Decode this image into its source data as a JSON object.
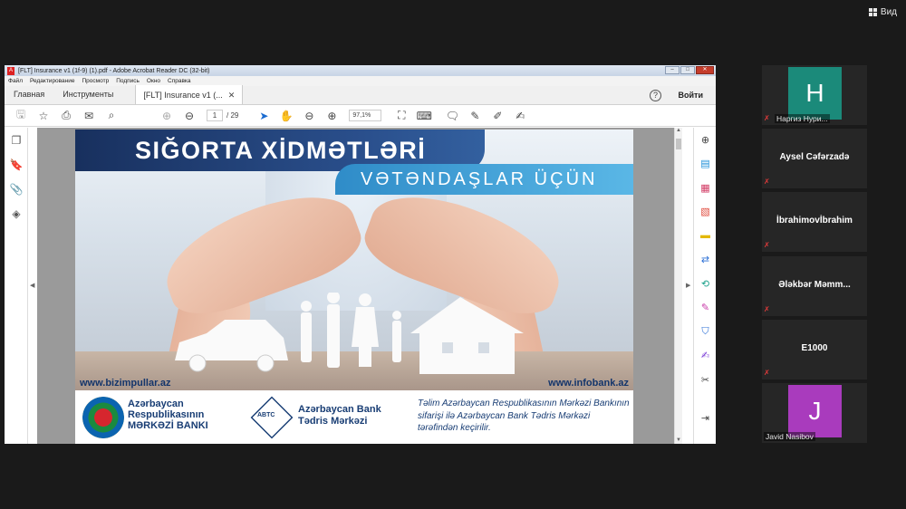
{
  "view_label": "Вид",
  "acrobat": {
    "title": "[FLT] Insurance v1 (1f-9) (1).pdf - Adobe Acrobat Reader DC (32-bit)",
    "menu": [
      "Файл",
      "Редактирование",
      "Просмотр",
      "Подпись",
      "Окно",
      "Справка"
    ],
    "tabs": {
      "home": "Главная",
      "tools": "Инструменты",
      "doc": "[FLT] Insurance v1 (..."
    },
    "help": "?",
    "signin": "Войти",
    "page_current": "1",
    "page_total": "/ 29",
    "zoom": "97,1%"
  },
  "slide": {
    "title": "SIĞORTA XİDMƏTLƏRİ",
    "subtitle": "VƏTƏNDAŞLAR ÜÇÜN",
    "url_left": "www.bizimpullar.az",
    "url_right": "www.infobank.az",
    "cb_line1": "Azərbaycan",
    "cb_line2": "Respublikasının",
    "cb_line3": "MƏRKƏZİ BANKI",
    "abtc": "ABTC",
    "bank_line1": "Azərbaycan Bank",
    "bank_line2": "Tədris Mərkəzi",
    "note": "Təlim Azərbaycan Respublikasının Mərkəzi Bankının sifarişi ilə Azərbaycan Bank Tədris Mərkəzi tərəfindən keçirilir."
  },
  "participants": [
    {
      "name": "Наргиз Нури...",
      "initial": "H",
      "color": "#1b8a7a"
    },
    {
      "name": "Aysel Cəfərzadə"
    },
    {
      "name": "İbrahimovİbrahim"
    },
    {
      "name": "Ələkbər  Məmm..."
    },
    {
      "name": "E1000"
    },
    {
      "name": "Javid Nasibov",
      "initial": "J",
      "color": "#a93bbd"
    }
  ]
}
